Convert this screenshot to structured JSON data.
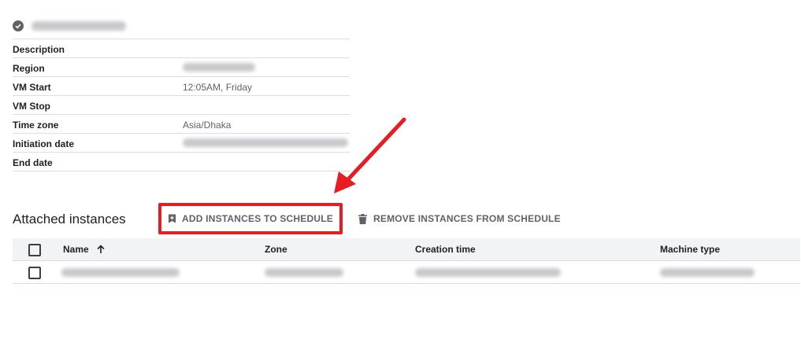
{
  "details": {
    "rows": [
      {
        "label": "Description",
        "value": ""
      },
      {
        "label": "Region",
        "value": ""
      },
      {
        "label": "VM Start",
        "value": "12:05AM, Friday"
      },
      {
        "label": "VM Stop",
        "value": ""
      },
      {
        "label": "Time zone",
        "value": "Asia/Dhaka"
      },
      {
        "label": "Initiation date",
        "value": ""
      },
      {
        "label": "End date",
        "value": ""
      }
    ]
  },
  "instances": {
    "title": "Attached instances",
    "add_label": "ADD INSTANCES TO SCHEDULE",
    "remove_label": "REMOVE INSTANCES FROM SCHEDULE",
    "columns": [
      "Name",
      "Zone",
      "Creation time",
      "Machine type"
    ],
    "sort_icon": "arrow-up-icon"
  },
  "colors": {
    "annotation": "#e81d23",
    "muted_text": "#5f6368",
    "header_bg": "#f1f3f4"
  }
}
